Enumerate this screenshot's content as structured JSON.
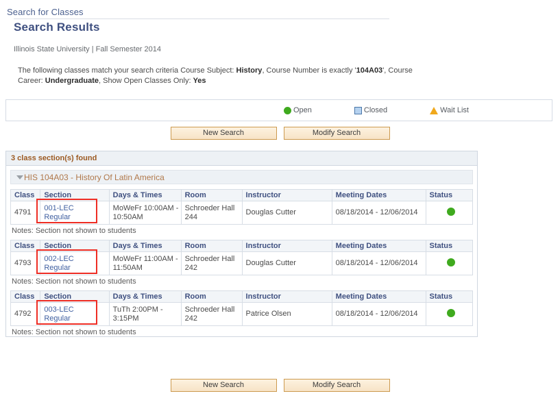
{
  "header": {
    "breadcrumb_link": "Search for Classes",
    "page_title": "Search Results",
    "institution_line": "Illinois State University | Fall Semester 2014"
  },
  "criteria": {
    "lead": "The following classes match your search criteria Course Subject: ",
    "subject": "History",
    "mid1": ",  Course Number is exactly '",
    "course_number": "104A03",
    "mid2": "',  Course Career: ",
    "career": "Undergraduate",
    "mid3": ",  Show Open Classes Only: ",
    "open_only": "Yes"
  },
  "legend": {
    "items": [
      {
        "icon": "open-circle-icon",
        "label": "Open",
        "color": "#3faa1e"
      },
      {
        "icon": "closed-square-icon",
        "label": "Closed",
        "color": "#4a76a8"
      },
      {
        "icon": "wait-list-triangle-icon",
        "label": "Wait List",
        "color": "#f0a81c"
      }
    ]
  },
  "buttons": {
    "new_search": "New Search",
    "modify_search": "Modify Search"
  },
  "results": {
    "found_label": "3 class section(s) found",
    "course_bar": "HIS 104A03 - History Of Latin America",
    "columns": [
      "Class",
      "Section",
      "Days & Times",
      "Room",
      "Instructor",
      "Meeting Dates",
      "Status"
    ],
    "notes_label": "Notes: Section not shown to students",
    "sections": [
      {
        "class": "4791",
        "section_code": "001-LEC",
        "section_type": "Regular",
        "days_times": "MoWeFr 10:00AM - 10:50AM",
        "room": "Schroeder Hall 244",
        "instructor": "Douglas Cutter",
        "meeting_dates": "08/18/2014 - 12/06/2014",
        "status": "Open",
        "notes": "Notes: Section not shown to students"
      },
      {
        "class": "4793",
        "section_code": "002-LEC",
        "section_type": "Regular",
        "days_times": "MoWeFr 11:00AM - 11:50AM",
        "room": "Schroeder Hall 242",
        "instructor": "Douglas Cutter",
        "meeting_dates": "08/18/2014 - 12/06/2014",
        "status": "Open",
        "notes": "Notes: Section not shown to students"
      },
      {
        "class": "4792",
        "section_code": "003-LEC",
        "section_type": "Regular",
        "days_times": "TuTh 2:00PM - 3:15PM",
        "room": "Schroeder Hall 242",
        "instructor": "Patrice Olsen",
        "meeting_dates": "08/18/2014 - 12/06/2014",
        "status": "Open",
        "notes": "Notes: Section not shown to students"
      }
    ]
  },
  "annotation": {
    "color": "#ee2d24",
    "targets": [
      "section-cell-0",
      "section-cell-1",
      "section-cell-2"
    ]
  }
}
